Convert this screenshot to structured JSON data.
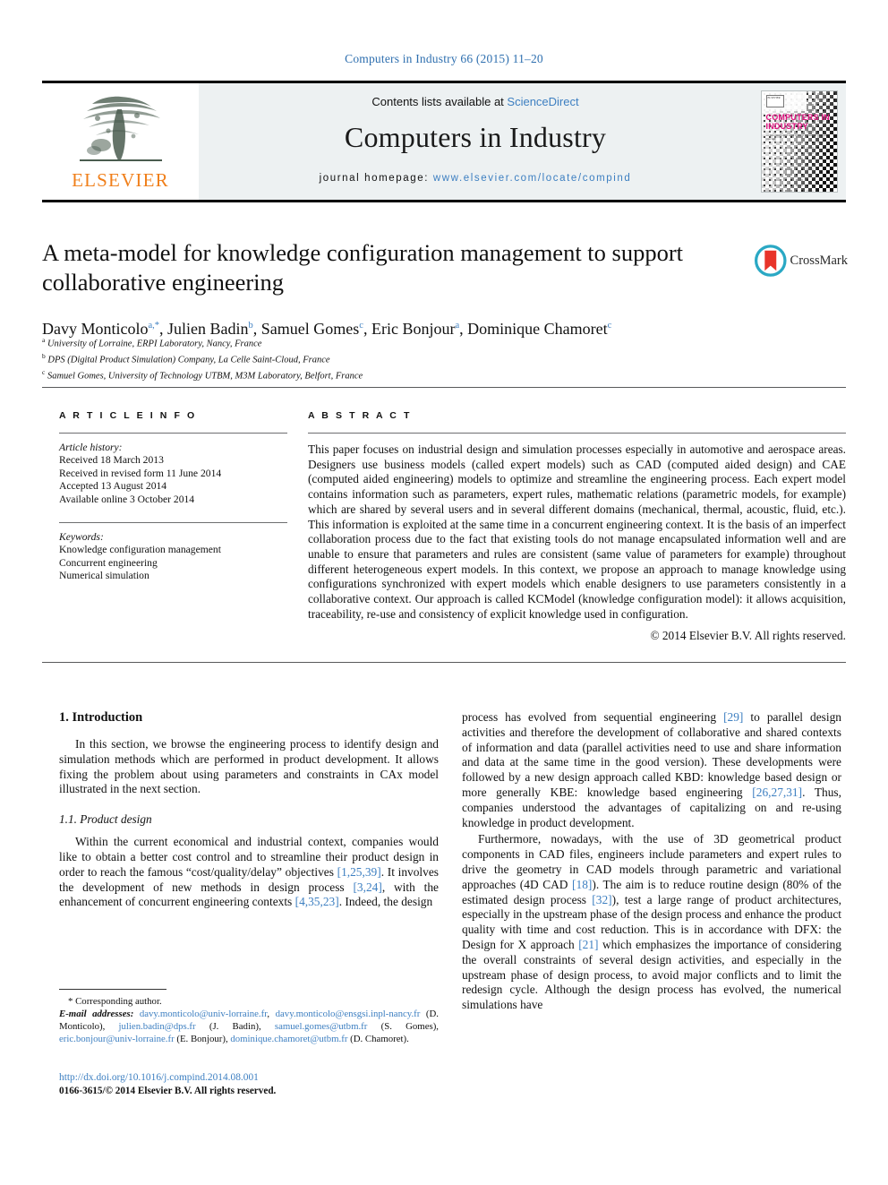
{
  "running_head": "Computers in Industry 66 (2015) 11–20",
  "masthead": {
    "contents_prefix": "Contents lists available at ",
    "sciencedirect": "ScienceDirect",
    "journal_title": "Computers in Industry",
    "homepage_label": "journal homepage:",
    "homepage_url": "www.elsevier.com/locate/compind",
    "publisher_wordmark": "ELSEVIER",
    "publisher_logo_icon": "elsevier-tree-icon",
    "cover": {
      "imprint": "ELSEVIER",
      "title_line1": "COMPUTERS IN",
      "title_line2": "INDUSTRY",
      "subtitle": "an international application oriented research journal",
      "title_color": "#e0117f"
    }
  },
  "article": {
    "title": "A meta-model for knowledge configuration management to support collaborative engineering",
    "authors": [
      {
        "name": "Davy Monticolo",
        "marks": "a,*"
      },
      {
        "name": "Julien Badin",
        "marks": "b"
      },
      {
        "name": "Samuel Gomes",
        "marks": "c"
      },
      {
        "name": "Eric Bonjour",
        "marks": "a"
      },
      {
        "name": "Dominique Chamoret",
        "marks": "c"
      }
    ],
    "affiliations": [
      {
        "mark": "a",
        "text": "University of Lorraine, ERPI Laboratory, Nancy, France"
      },
      {
        "mark": "b",
        "text": "DPS (Digital Product Simulation) Company, La Celle Saint-Cloud, France"
      },
      {
        "mark": "c",
        "text": "Samuel Gomes, University of Technology UTBM, M3M Laboratory, Belfort, France"
      }
    ],
    "crossmark": {
      "label": "CrossMark",
      "icon": "crossmark-icon"
    }
  },
  "article_info": {
    "heading": "A R T I C L E   I N F O",
    "history_label": "Article history:",
    "history": [
      "Received 18 March 2013",
      "Received in revised form 11 June 2014",
      "Accepted 13 August 2014",
      "Available online 3 October 2014"
    ],
    "keywords_label": "Keywords:",
    "keywords": [
      "Knowledge configuration management",
      "Concurrent engineering",
      "Numerical simulation"
    ]
  },
  "abstract": {
    "heading": "A B S T R A C T",
    "text": "This paper focuses on industrial design and simulation processes especially in automotive and aerospace areas. Designers use business models (called expert models) such as CAD (computed aided design) and CAE (computed aided engineering) models to optimize and streamline the engineering process. Each expert model contains information such as parameters, expert rules, mathematic relations (parametric models, for example) which are shared by several users and in several different domains (mechanical, thermal, acoustic, fluid, etc.). This information is exploited at the same time in a concurrent engineering context. It is the basis of an imperfect collaboration process due to the fact that existing tools do not manage encapsulated information well and are unable to ensure that parameters and rules are consistent (same value of parameters for example) throughout different heterogeneous expert models. In this context, we propose an approach to manage knowledge using configurations synchronized with expert models which enable designers to use parameters consistently in a collaborative context. Our approach is called KCModel (knowledge configuration model): it allows acquisition, traceability, re-use and consistency of explicit knowledge used in configuration.",
    "copyright": "© 2014 Elsevier B.V. All rights reserved."
  },
  "body": {
    "section1_heading": "1. Introduction",
    "p1": "In this section, we browse the engineering process to identify design and simulation methods which are performed in product development. It allows fixing the problem about using parameters and constraints in CAx model illustrated in the next section.",
    "subsection11_heading": "1.1. Product design",
    "p2_parts": [
      {
        "t": "Within the current economical and industrial context, companies would like to obtain a better cost control and to streamline their product design in order to reach the famous “cost/quality/delay” objectives ",
        "ref": false
      },
      {
        "t": "[1,25,39]",
        "ref": true
      },
      {
        "t": ". It involves the development of new methods in design process ",
        "ref": false
      },
      {
        "t": "[3,24]",
        "ref": true
      },
      {
        "t": ", with the enhancement of concurrent engineering contexts ",
        "ref": false
      },
      {
        "t": "[4,35,23]",
        "ref": true
      },
      {
        "t": ". Indeed, the design",
        "ref": false
      }
    ],
    "p3_parts": [
      {
        "t": "process has evolved from sequential engineering ",
        "ref": false
      },
      {
        "t": "[29]",
        "ref": true
      },
      {
        "t": " to parallel design activities and therefore the development of collaborative and shared contexts of information and data (parallel activities need to use and share information and data at the same time in the good version). These developments were followed by a new design approach called KBD: knowledge based design or more generally KBE: knowledge based engineering ",
        "ref": false
      },
      {
        "t": "[26,27,31]",
        "ref": true
      },
      {
        "t": ". Thus, companies understood the advantages of capitalizing on and re-using knowledge in product development.",
        "ref": false
      }
    ],
    "p4_parts": [
      {
        "t": "Furthermore, nowadays, with the use of 3D geometrical product components in CAD files, engineers include parameters and expert rules to drive the geometry in CAD models through parametric and variational approaches (4D CAD ",
        "ref": false
      },
      {
        "t": "[18]",
        "ref": true
      },
      {
        "t": "). The aim is to reduce routine design (80% of the estimated design process ",
        "ref": false
      },
      {
        "t": "[32]",
        "ref": true
      },
      {
        "t": "), test a large range of product architectures, especially in the upstream phase of the design process and enhance the product quality with time and cost reduction. This is in accordance with DFX: the Design for X approach ",
        "ref": false
      },
      {
        "t": "[21]",
        "ref": true
      },
      {
        "t": " which emphasizes the importance of considering the overall constraints of several design activities, and especially in the upstream phase of design process, to avoid major conflicts and to limit the redesign cycle. Although the design process has evolved, the numerical simulations have",
        "ref": false
      }
    ]
  },
  "footnotes": {
    "corresponding": "* Corresponding author.",
    "email_label": "E-mail addresses:",
    "emails": [
      {
        "addr": "davy.monticolo@univ-lorraine.fr",
        "owner": ""
      },
      {
        "addr": "davy.monticolo@ensgsi.inpl-nancy.fr",
        "owner": "(D. Monticolo)"
      },
      {
        "addr": "julien.badin@dps.fr",
        "owner": "(J. Badin)"
      },
      {
        "addr": "samuel.gomes@utbm.fr",
        "owner": "(S. Gomes)"
      },
      {
        "addr": "eric.bonjour@univ-lorraine.fr",
        "owner": "(E. Bonjour)"
      },
      {
        "addr": "dominique.chamoret@utbm.fr",
        "owner": "(D. Chamoret)."
      }
    ],
    "doi": "http://dx.doi.org/10.1016/j.compind.2014.08.001",
    "issn_line": "0166-3615/© 2014 Elsevier B.V. All rights reserved."
  },
  "colors": {
    "link_blue": "#3d7fc1",
    "elsevier_orange": "#f07f1a",
    "masthead_bg": "#edf1f2",
    "cover_pink": "#e0117f",
    "crossmark_red": "#e8342a",
    "crossmark_teal": "#2aa8c4"
  }
}
